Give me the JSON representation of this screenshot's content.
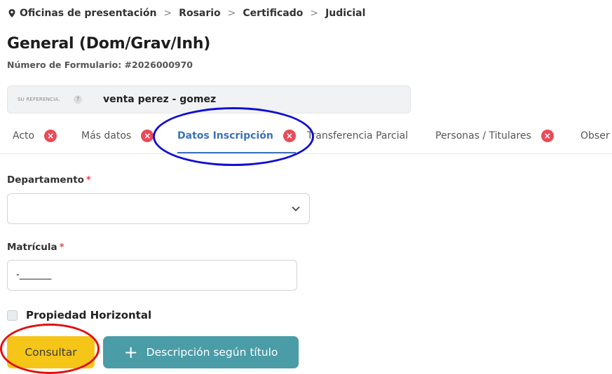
{
  "breadcrumb": {
    "items": [
      "Oficinas de presentación",
      "Rosario",
      "Certificado",
      "Judicial"
    ],
    "separator": ">",
    "icon": "map-marker-icon"
  },
  "page": {
    "title": "General (Dom/Grav/Inh)",
    "form_number": "Número de Formulario: #2026000970"
  },
  "reference": {
    "label": "SU REFERENCIA.",
    "help": "?",
    "value": "venta perez - gomez"
  },
  "tabs": [
    {
      "label": "Acto",
      "error": true,
      "error_icon": "×"
    },
    {
      "label": "Más datos",
      "error": true,
      "error_icon": "×"
    },
    {
      "label": "Datos Inscripción",
      "error": true,
      "error_icon": "×",
      "active": true
    },
    {
      "label": "Transferencia Parcial",
      "error": false
    },
    {
      "label": "Personas / Titulares",
      "error": true,
      "error_icon": "×"
    },
    {
      "label": "Obser",
      "error": false
    }
  ],
  "form": {
    "departamento_label": "Departamento",
    "departamento_value": "",
    "matricula_label": "Matrícula",
    "matricula_value": "-_______",
    "required_mark": "*",
    "propiedad_label": "Propiedad Horizontal",
    "propiedad_checked": false
  },
  "buttons": {
    "consultar": "Consultar",
    "descripcion": "Descripción según título",
    "descripcion_icon": "+"
  },
  "colors": {
    "accent": "#3b73b9",
    "error": "#e74c5a",
    "consultar_bg": "#f5c518",
    "descripcion_bg": "#4a9ca7",
    "annotation_blue": "#1010d0",
    "annotation_red": "#e01010"
  }
}
